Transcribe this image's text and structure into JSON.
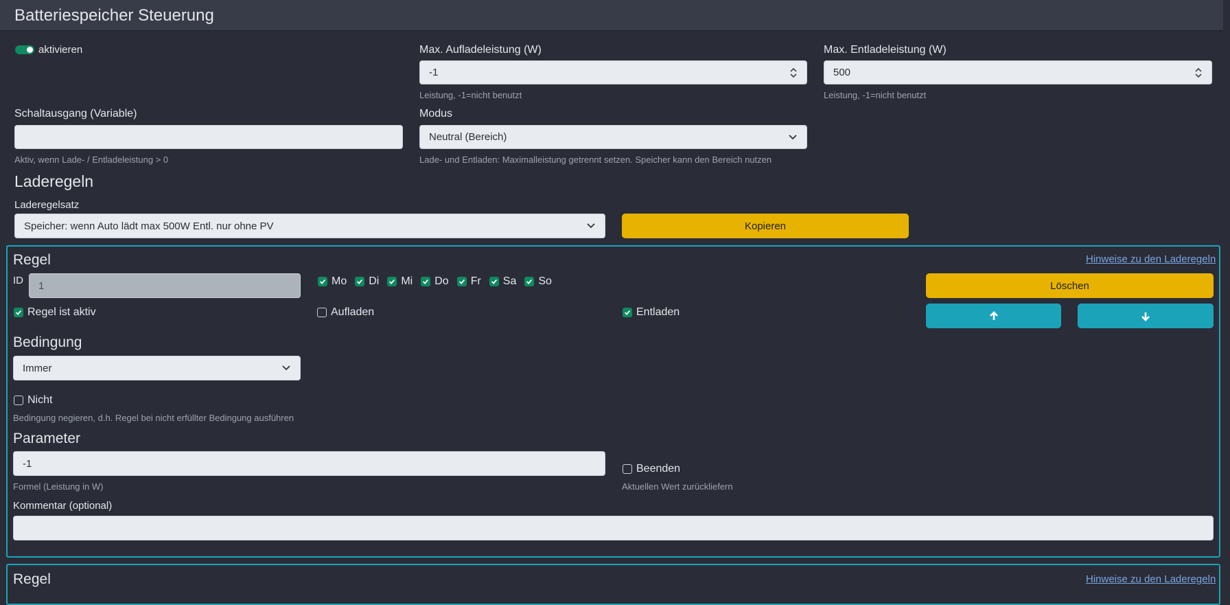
{
  "header": {
    "title": "Batteriespeicher Steuerung"
  },
  "general": {
    "activate_label": "aktivieren",
    "max_charge": {
      "label": "Max. Aufladeleistung (W)",
      "value": "-1",
      "help": "Leistung, -1=nicht benutzt"
    },
    "max_discharge": {
      "label": "Max. Entladeleistung (W)",
      "value": "500",
      "help": "Leistung, -1=nicht benutzt"
    },
    "switch_output": {
      "label": "Schaltausgang (Variable)",
      "value": "",
      "help": "Aktiv, wenn Lade- / Entladeleistung > 0"
    },
    "mode": {
      "label": "Modus",
      "value": "Neutral (Bereich)",
      "help": "Lade- und Entladen: Maximalleistung getrennt setzen. Speicher kann den Bereich nutzen"
    }
  },
  "rules": {
    "title": "Laderegeln",
    "ruleset_label": "Laderegelsatz",
    "ruleset_value": "Speicher: wenn Auto lädt max 500W Entl. nur ohne PV",
    "copy_label": "Kopieren"
  },
  "rule1": {
    "title": "Regel",
    "hint_link": "Hinweise zu den Laderegeln",
    "id_label": "ID",
    "id_value": "1",
    "days": [
      "Mo",
      "Di",
      "Mi",
      "Do",
      "Fr",
      "Sa",
      "So"
    ],
    "active_label": "Regel ist aktiv",
    "charge_label": "Aufladen",
    "discharge_label": "Entladen",
    "delete_label": "Löschen",
    "condition_title": "Bedingung",
    "condition_value": "Immer",
    "not_label": "Nicht",
    "not_help": "Bedingung negieren, d.h. Regel bei nicht erfüllter Bedingung ausführen",
    "parameter_title": "Parameter",
    "parameter_value": "-1",
    "parameter_help": "Formel (Leistung in W)",
    "end_label": "Beenden",
    "end_help": "Aktuellen Wert zurückliefern",
    "comment_label": "Kommentar (optional)",
    "comment_value": ""
  },
  "rule2": {
    "title": "Regel",
    "hint_link": "Hinweise zu den Laderegeln"
  },
  "icons": {
    "spinner": "up-down-arrows-icon",
    "select": "chevron-down-icon",
    "move_up": "arrow-up-icon",
    "move_down": "arrow-down-icon"
  },
  "colors": {
    "background": "#2a2d38",
    "header": "#383c48",
    "accent_yellow": "#e7b300",
    "accent_cyan": "#1ba3b9",
    "check_green": "#0f8a5f",
    "link": "#7aa3e0"
  }
}
